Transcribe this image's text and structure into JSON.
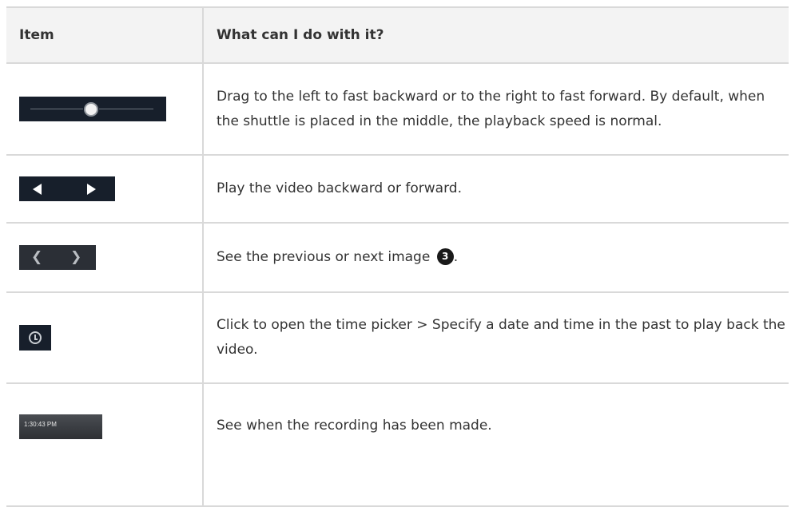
{
  "table": {
    "headers": [
      "Item",
      "What can I do with it?"
    ],
    "rows": [
      {
        "item_icon": "playback-speed-shuttle",
        "description": "Drag to the left to fast backward or to the right to fast forward. By default, when the shuttle is placed in the middle, the playback speed is normal."
      },
      {
        "item_icon": "play-backward-forward-buttons",
        "description": "Play the video backward or forward."
      },
      {
        "item_icon": "previous-next-image-buttons",
        "description": "See the previous or next image",
        "callout": "3",
        "description_suffix": "."
      },
      {
        "item_icon": "clock-icon",
        "description": "Click to open the time picker > Specify a date and time in the past to play back the video."
      },
      {
        "item_icon": "recording-time-display",
        "item_text": "1:30:43 PM",
        "description": "See when the recording has been made."
      }
    ]
  },
  "colors": {
    "header_background": "#f3f3f3",
    "border": "#d9d9d9",
    "control_background": "#171f2b",
    "text": "#333333"
  }
}
